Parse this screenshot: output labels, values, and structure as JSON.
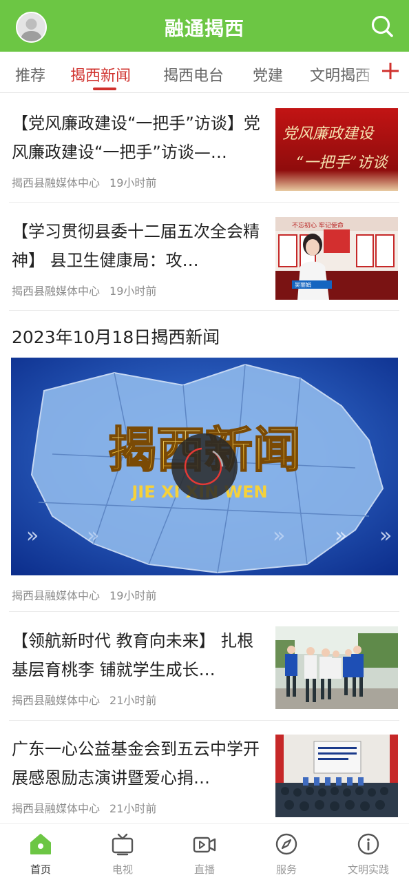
{
  "header": {
    "title": "融通揭西",
    "avatar_icon": "user-avatar-icon",
    "search_icon": "search-icon",
    "brand_color": "#6cc644"
  },
  "tabs": {
    "items": [
      {
        "label": "推荐",
        "active": false
      },
      {
        "label": "揭西新闻",
        "active": true
      },
      {
        "label": "揭西电台",
        "active": false
      },
      {
        "label": "党建",
        "active": false
      },
      {
        "label": "文明揭西",
        "active": false
      }
    ],
    "add_icon": "plus-icon",
    "active_color": "#d0312d"
  },
  "news": [
    {
      "title": "【党风廉政建设“一把手”访谈】党风廉政建设“一把手”访谈—…",
      "source": "揭西县融媒体中心",
      "time": "19小时前",
      "thumb_text_1": "党风廉政建设",
      "thumb_text_2": "“一把手”访谈"
    },
    {
      "title": "【学习贯彻县委十二届五次全会精神】 县卫生健康局：攻…",
      "source": "揭西县融媒体中心",
      "time": "19小时前",
      "thumb_text_1": "不忘初心 牢记使命",
      "thumb_text_2": "吴丽娟"
    },
    {
      "title": "【领航新时代 教育向未来】 扎根基层育桃李 铺就学生成长…",
      "source": "揭西县融媒体中心",
      "time": "21小时前"
    },
    {
      "title": "广东一心公益基金会到五云中学开展感恩励志演讲暨爱心捐…",
      "source": "揭西县融媒体中心",
      "time": "21小时前"
    }
  ],
  "video": {
    "title": "2023年10月18日揭西新闻",
    "overlay_title": "揭西新闻",
    "overlay_subtitle": "JIE XI XIN WEN",
    "source": "揭西县融媒体中心",
    "time": "19小时前",
    "play_icon": "play-icon"
  },
  "bottom_nav": [
    {
      "label": "首页",
      "icon": "home-icon",
      "active": true
    },
    {
      "label": "电视",
      "icon": "tv-icon",
      "active": false
    },
    {
      "label": "直播",
      "icon": "live-video-icon",
      "active": false
    },
    {
      "label": "服务",
      "icon": "compass-icon",
      "active": false
    },
    {
      "label": "文明实践",
      "icon": "info-icon",
      "active": false
    }
  ]
}
